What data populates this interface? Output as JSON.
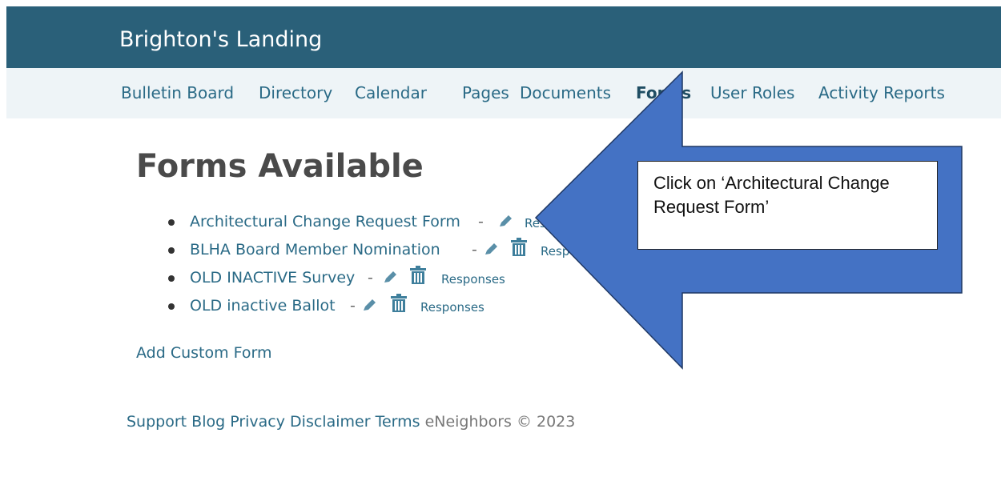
{
  "header": {
    "site_title": "Brighton's Landing"
  },
  "nav": {
    "items": [
      {
        "label": "Bulletin Board"
      },
      {
        "label": "Directory"
      },
      {
        "label": "Calendar"
      },
      {
        "label": "Pages"
      },
      {
        "label": "Documents"
      },
      {
        "label": "Forms",
        "active": true
      },
      {
        "label": "User Roles"
      },
      {
        "label": "Activity Reports"
      }
    ]
  },
  "main": {
    "title": "Forms Available",
    "forms": [
      {
        "name": "Architectural Change Request Form",
        "separator": "-",
        "responses_label": "Responses"
      },
      {
        "name": "BLHA Board Member Nomination",
        "separator": "-",
        "responses_label": "Responses"
      },
      {
        "name": "OLD INACTIVE Survey",
        "separator": "-",
        "responses_label": "Responses"
      },
      {
        "name": "OLD inactive Ballot",
        "separator": "-",
        "responses_label": "Responses"
      }
    ],
    "add_form_label": "Add Custom Form"
  },
  "footer": {
    "support": "Support",
    "blog": "Blog",
    "privacy": "Privacy",
    "disclaimer": "Disclaimer",
    "terms": "Terms",
    "copyright": "eNeighbors © 2023"
  },
  "annotation": {
    "callout_text": "Click on ‘Architectural Change Request Form’",
    "arrow_color": "#4472c4",
    "arrow_outline": "#1f3864"
  },
  "icons": {
    "edit": "pencil-icon",
    "delete": "trash-icon"
  },
  "colors": {
    "header_bg": "#2a6079",
    "nav_bg": "#eef4f7",
    "link": "#2a6a86"
  }
}
